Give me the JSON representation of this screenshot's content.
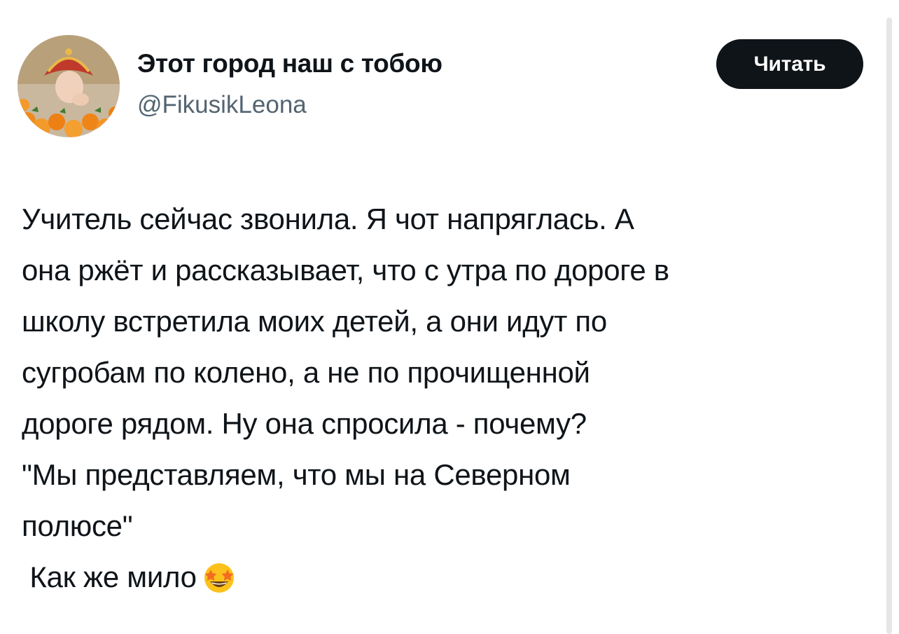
{
  "author": {
    "display_name": "Этот город наш с тобою",
    "handle": "@FikusikLeona",
    "avatar_icon": "profile-photo"
  },
  "follow_button": {
    "label": "Читать"
  },
  "tweet": {
    "lines": [
      "Учитель сейчас звонила. Я чот напряглась. А",
      "она ржёт и рассказывает, что с утра по дороге в",
      "школу встретила моих детей, а они идут по",
      "сугробам по колено, а не по прочищенной",
      "дороге рядом. Ну она спросила - почему?",
      "\"Мы представляем, что мы на Северном",
      "полюсе\"",
      " Как же мило"
    ],
    "emoji": "star-struck-emoji"
  },
  "colors": {
    "text": "#0f1419",
    "secondary_text": "#536471",
    "button_bg": "#0f1419",
    "button_text": "#ffffff"
  }
}
